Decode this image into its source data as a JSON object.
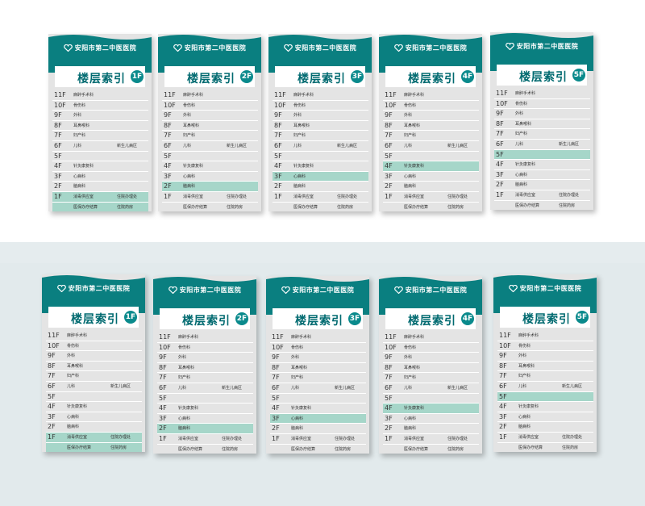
{
  "hospital_name": "安阳市第二中医医院",
  "title": "楼层索引",
  "colors": {
    "teal": "#0a7f80",
    "highlight": "#a6d6c9",
    "panel": "#e4e4e4"
  },
  "floors": [
    {
      "floor": "11F",
      "d1": "麻醉手术科",
      "d2": ""
    },
    {
      "floor": "10F",
      "d1": "骨伤科",
      "d2": ""
    },
    {
      "floor": "9F",
      "d1": "外科",
      "d2": ""
    },
    {
      "floor": "8F",
      "d1": "耳鼻喉科",
      "d2": ""
    },
    {
      "floor": "7F",
      "d1": "妇产科",
      "d2": ""
    },
    {
      "floor": "6F",
      "d1": "儿科",
      "d2": "新生儿病区"
    },
    {
      "floor": "5F",
      "d1": "",
      "d2": ""
    },
    {
      "floor": "4F",
      "d1": "针灸康复科",
      "d2": ""
    },
    {
      "floor": "3F",
      "d1": "心病科",
      "d2": ""
    },
    {
      "floor": "2F",
      "d1": "脑病科",
      "d2": ""
    },
    {
      "floor": "1F",
      "d1": "消毒供应室",
      "d2": "住院办理处"
    }
  ],
  "extra_line": {
    "d1": "医保办疗结算",
    "d2": "住院药房"
  },
  "signs": [
    {
      "badge": "1F",
      "highlight": "1F"
    },
    {
      "badge": "2F",
      "highlight": "2F"
    },
    {
      "badge": "3F",
      "highlight": "3F"
    },
    {
      "badge": "4F",
      "highlight": "4F"
    },
    {
      "badge": "5F",
      "highlight": "5F"
    }
  ]
}
